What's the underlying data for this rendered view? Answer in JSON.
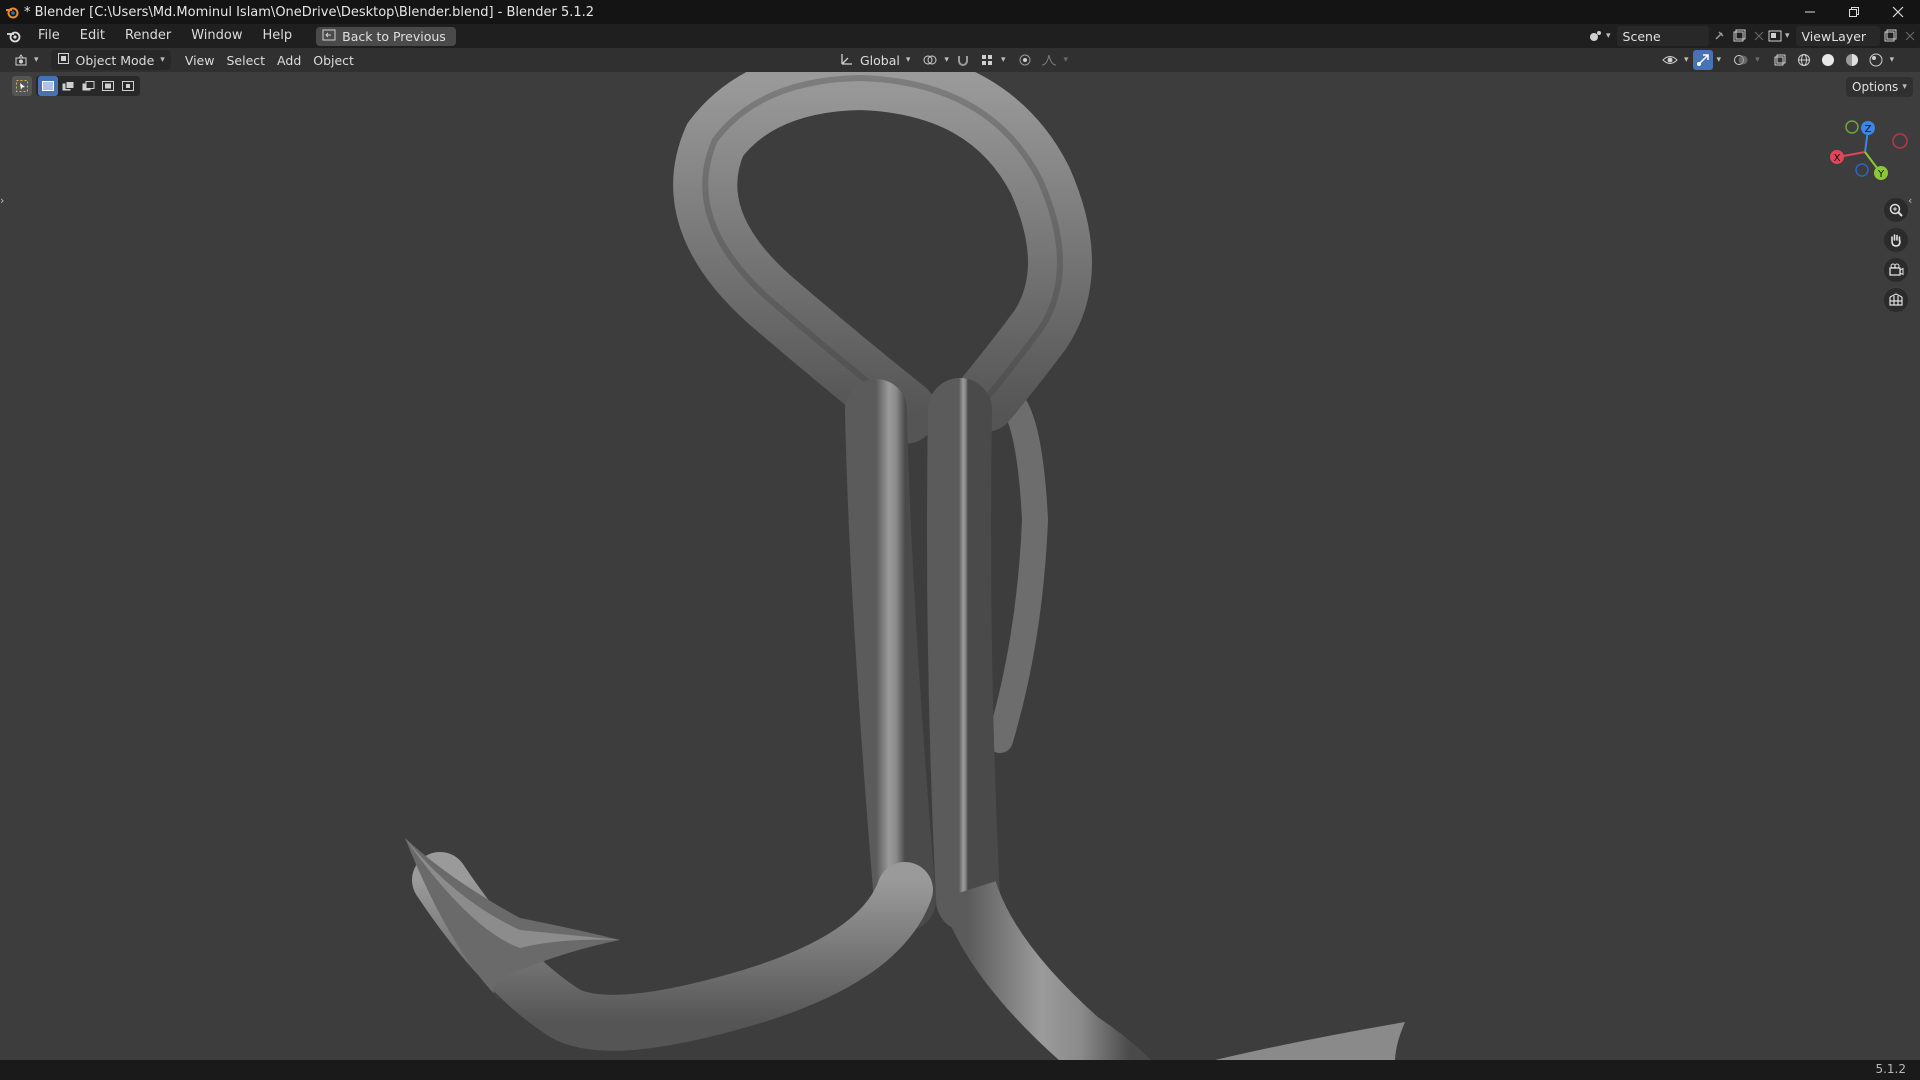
{
  "window": {
    "title": "* Blender [C:\\Users\\Md.Mominul Islam\\OneDrive\\Desktop\\Blender.blend] - Blender 5.1.2"
  },
  "menu": {
    "items": [
      "File",
      "Edit",
      "Render",
      "Window",
      "Help"
    ],
    "back_button": "Back to Previous"
  },
  "scene": {
    "name": "Scene"
  },
  "view_layer": {
    "name": "ViewLayer"
  },
  "viewport_header": {
    "mode": "Object Mode",
    "menus": [
      "View",
      "Select",
      "Add",
      "Object"
    ],
    "orientation": "Global"
  },
  "viewport": {
    "options_label": "Options",
    "gizmo_axes": {
      "x": "X",
      "y": "Y",
      "z": "Z"
    }
  },
  "status_bar": {
    "version": "5.1.2"
  },
  "colors": {
    "accent": "#4772b3",
    "axis_x": "#e0455a",
    "axis_y": "#8ac934",
    "axis_z": "#3c86e6",
    "viewport_bg": "#3d3d3d"
  },
  "icons": [
    "blender-logo-icon",
    "back-arrow-icon",
    "scene-icon",
    "pin-icon",
    "new-scene-icon",
    "view-layer-icon",
    "editor-type-icon",
    "object-mode-icon",
    "transform-orientation-icon",
    "pivot-icon",
    "snap-icon",
    "snap-increment-icon",
    "proportional-editing-icon",
    "falloff-icon",
    "visibility-icon",
    "gizmo-icon",
    "overlay-icon",
    "xray-icon",
    "wireframe-shading-icon",
    "solid-shading-icon",
    "material-shading-icon",
    "rendered-shading-icon",
    "select-box-tool-icon",
    "zoom-icon",
    "pan-hand-icon",
    "camera-icon",
    "orthographic-grid-icon"
  ]
}
